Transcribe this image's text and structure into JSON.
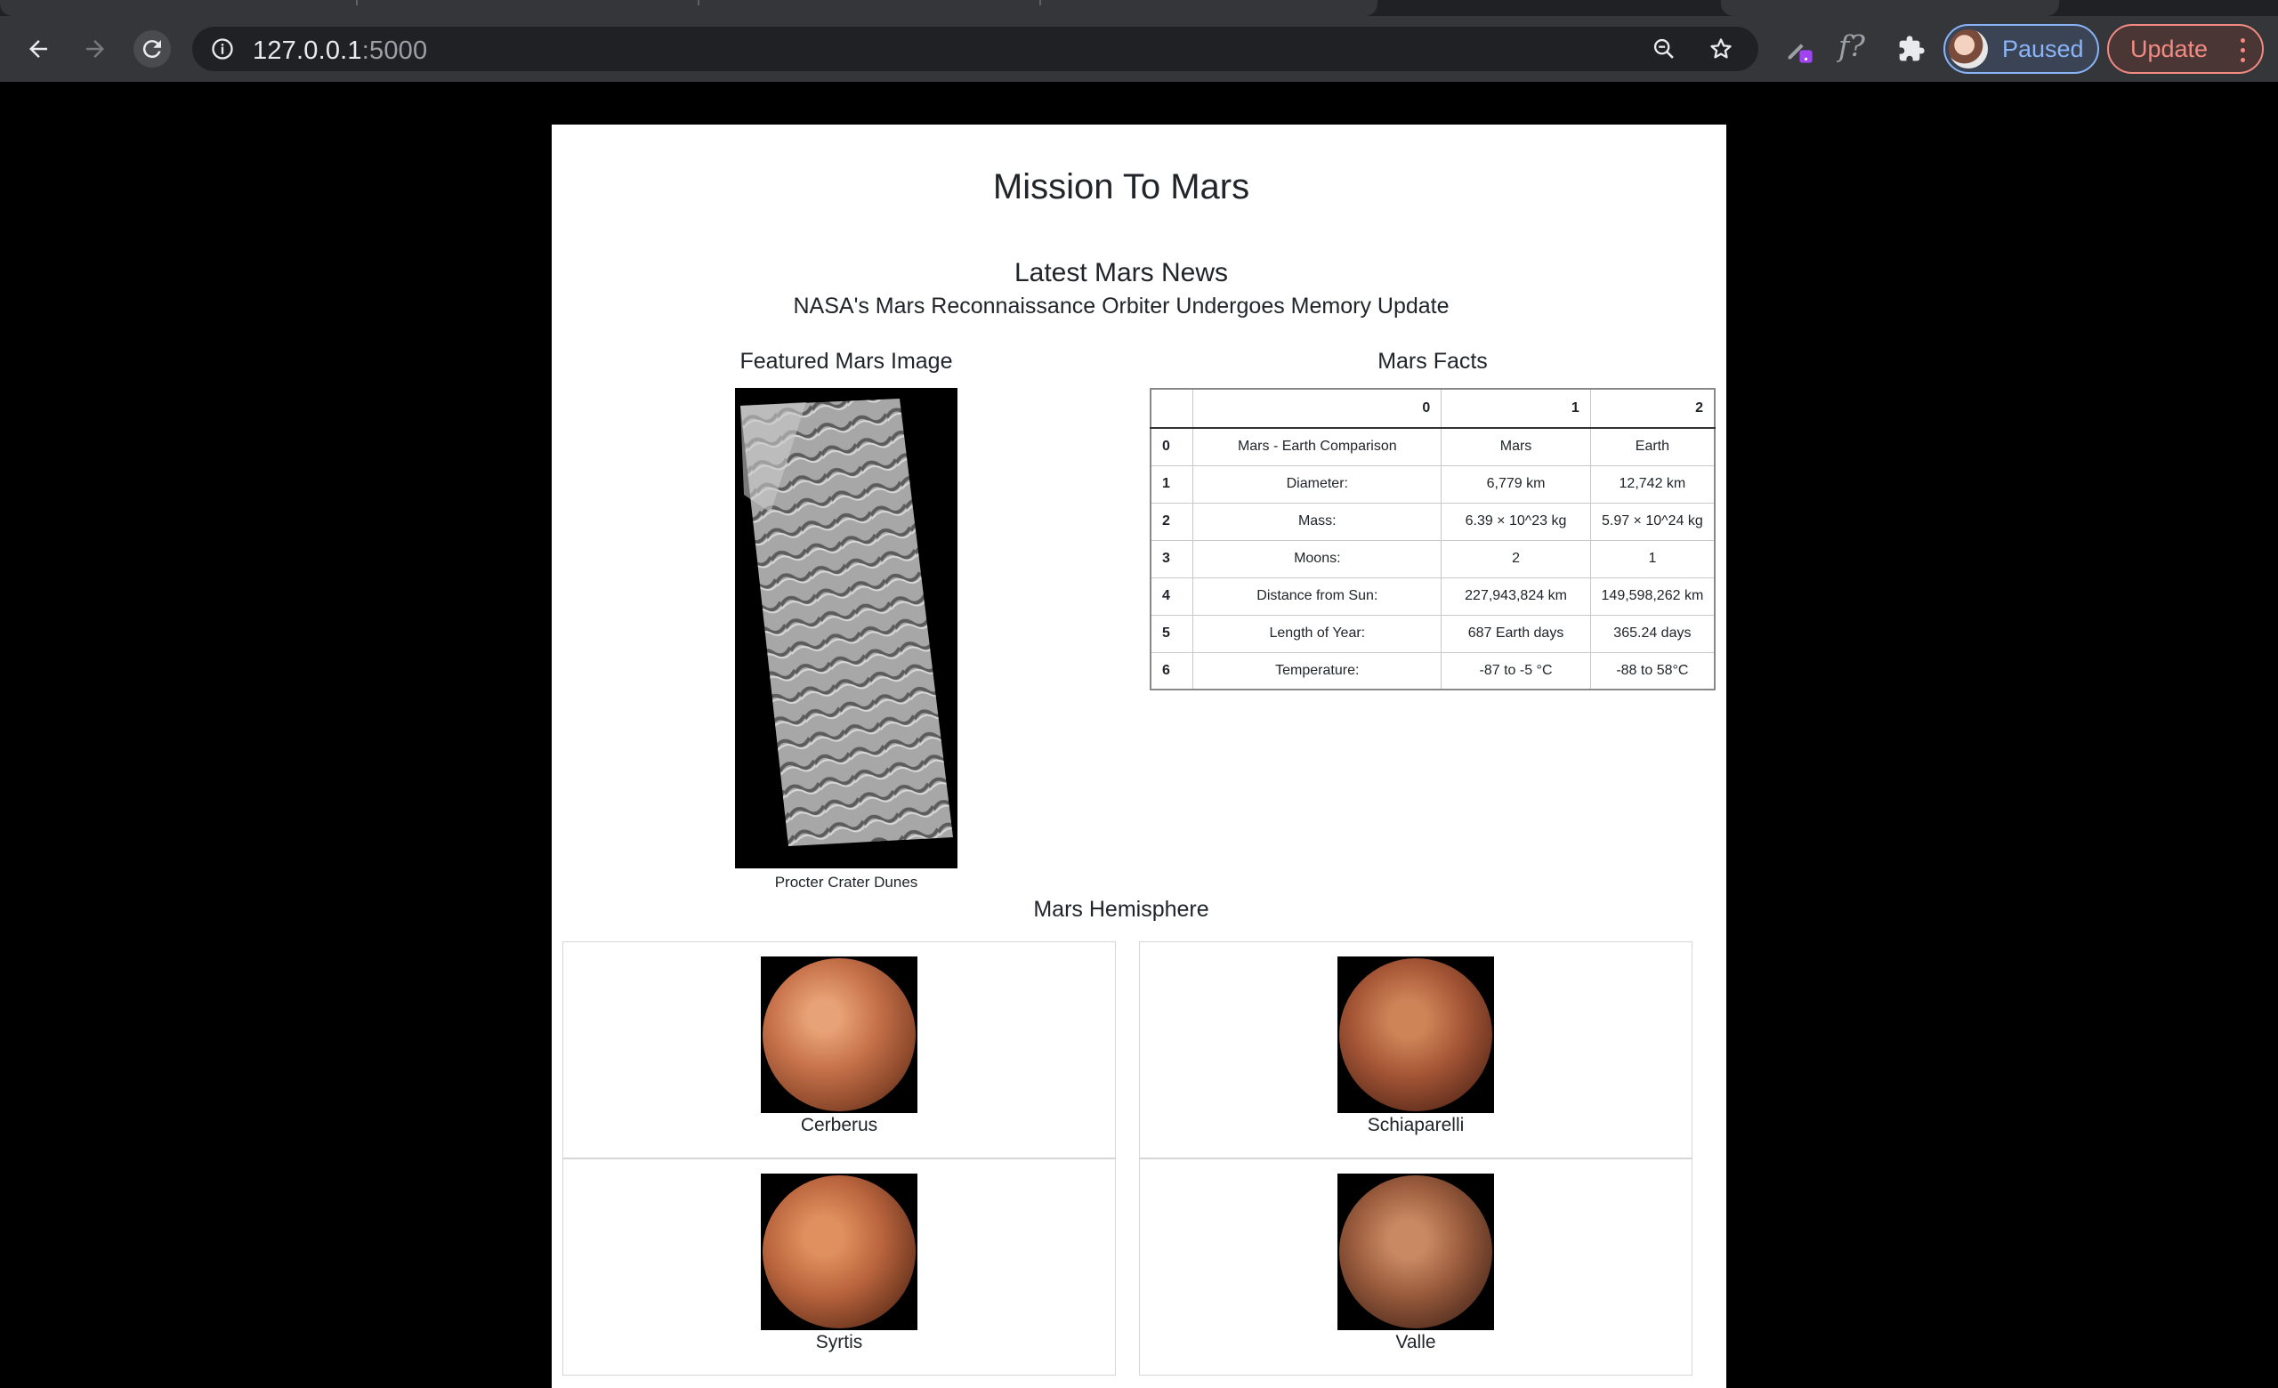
{
  "browser": {
    "url_host": "127.0.0.1",
    "url_port": ":5000",
    "profile_label": "Paused",
    "update_label": "Update",
    "accent_colors": {
      "profile": "#8ab4f8",
      "update": "#f28b82"
    }
  },
  "page": {
    "title": "Mission To Mars",
    "news": {
      "heading": "Latest Mars News",
      "title": "NASA's Mars Reconnaissance Orbiter Undergoes Memory Update"
    },
    "featured": {
      "heading": "Featured Mars Image",
      "caption": "Procter Crater Dunes"
    },
    "facts": {
      "heading": "Mars Facts",
      "columns": [
        "",
        "0",
        "1",
        "2"
      ],
      "rows": [
        {
          "index": "0",
          "label": "Mars - Earth Comparison",
          "mars": "Mars",
          "earth": "Earth"
        },
        {
          "index": "1",
          "label": "Diameter:",
          "mars": "6,779 km",
          "earth": "12,742 km"
        },
        {
          "index": "2",
          "label": "Mass:",
          "mars": "6.39 × 10^23 kg",
          "earth": "5.97 × 10^24 kg"
        },
        {
          "index": "3",
          "label": "Moons:",
          "mars": "2",
          "earth": "1"
        },
        {
          "index": "4",
          "label": "Distance from Sun:",
          "mars": "227,943,824 km",
          "earth": "149,598,262 km"
        },
        {
          "index": "5",
          "label": "Length of Year:",
          "mars": "687 Earth days",
          "earth": "365.24 days"
        },
        {
          "index": "6",
          "label": "Temperature:",
          "mars": "-87 to -5 °C",
          "earth": "-88 to 58°C"
        }
      ]
    },
    "hemispheres": {
      "heading": "Mars Hemisphere",
      "items": [
        {
          "name": "Cerberus"
        },
        {
          "name": "Schiaparelli"
        },
        {
          "name": "Syrtis"
        },
        {
          "name": "Valle"
        }
      ]
    }
  }
}
